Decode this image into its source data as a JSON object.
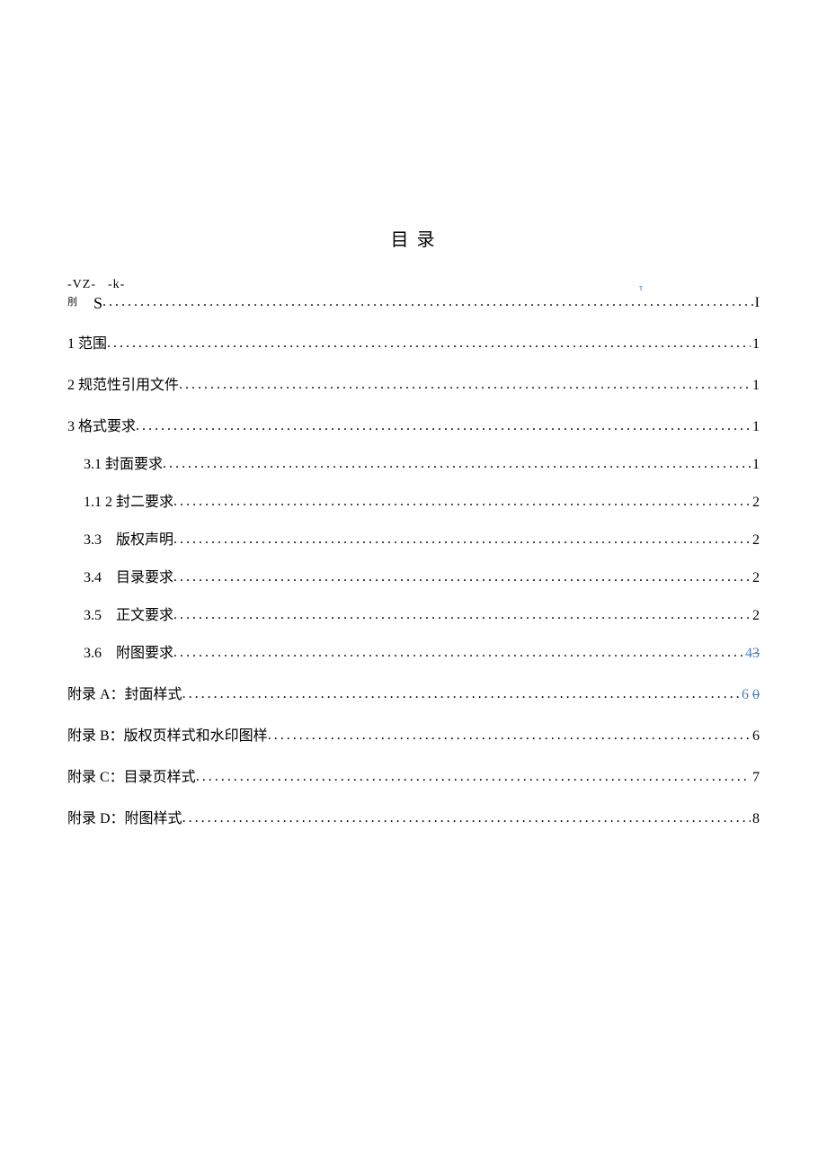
{
  "title": "目 录",
  "artifact": {
    "line1_vz": "-VZ-",
    "line1_k": "-k-",
    "tau": "τ",
    "del": "刖",
    "s": "S",
    "page": "I"
  },
  "entries": [
    {
      "level": 0,
      "label": "1 范围",
      "page": "1"
    },
    {
      "level": 0,
      "label": "2 规范性引用文件",
      "page": "1"
    },
    {
      "level": 0,
      "label": "3 格式要求",
      "page": "1"
    },
    {
      "level": 1,
      "label": "3.1 封面要求",
      "page": "1"
    },
    {
      "level": 1,
      "label": "1.1 2 封二要求",
      "page": "2"
    },
    {
      "level": 1,
      "label": "3.3　版权声明",
      "page": "2"
    },
    {
      "level": 1,
      "label": "3.4　目录要求",
      "page": "2"
    },
    {
      "level": 1,
      "label": "3.5　正文要求",
      "page": "2"
    },
    {
      "level": 1,
      "label": "3.6　附图要求",
      "page_new": "4",
      "page_old": "3",
      "tracked": true
    },
    {
      "level": 0,
      "label": "附录 A：封面样式",
      "page_new": "6",
      "page_old": "0",
      "tracked": true,
      "variant": "a"
    },
    {
      "level": 0,
      "label": "附录 B：版权页样式和水印图样",
      "page": "6"
    },
    {
      "level": 0,
      "label": "附录 C：目录页样式",
      "page": "7"
    },
    {
      "level": 0,
      "label": "附录 D：附图样式",
      "page": "8"
    }
  ]
}
